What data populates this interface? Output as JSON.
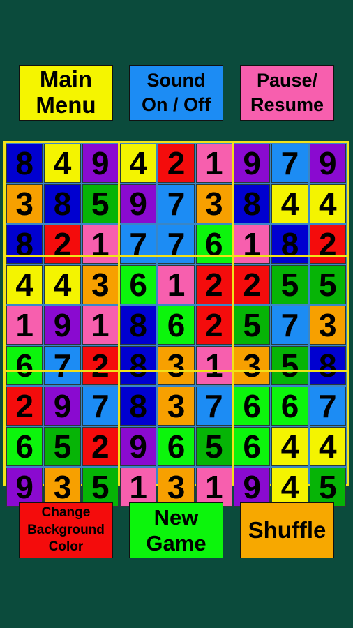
{
  "colors": {
    "background": "#0b4b3c",
    "grid_border": "#f2e21a",
    "digit_colors": {
      "1": "#f75fae",
      "2": "#f40c0c",
      "3": "#f7a000",
      "4": "#f4f400",
      "5": "#06b406",
      "6": "#0cf50c",
      "7": "#1c8cf4",
      "8": "#0000d0",
      "9": "#8a0ad0"
    }
  },
  "top_buttons": {
    "main_menu": {
      "line1": "Main",
      "line2": "Menu",
      "color": "#f5f500"
    },
    "sound": {
      "line1": "Sound",
      "line2": "On / Off",
      "color": "#1c8cf4"
    },
    "pause": {
      "line1": "Pause/",
      "line2": "Resume",
      "color": "#f75fae"
    }
  },
  "bottom_buttons": {
    "change_bg": {
      "line1": "Change",
      "line2": "Background",
      "line3": "Color",
      "color": "#f40c0c"
    },
    "new_game": {
      "line1": "New",
      "line2": "Game",
      "color": "#0cf50c"
    },
    "shuffle": {
      "label": "Shuffle",
      "color": "#f7a800"
    }
  },
  "grid": [
    [
      8,
      4,
      9,
      4,
      2,
      1,
      9,
      7,
      9
    ],
    [
      3,
      8,
      5,
      9,
      7,
      3,
      8,
      4,
      4
    ],
    [
      8,
      2,
      1,
      7,
      7,
      6,
      1,
      8,
      2
    ],
    [
      4,
      4,
      3,
      6,
      1,
      2,
      2,
      5,
      5
    ],
    [
      1,
      9,
      1,
      8,
      6,
      2,
      5,
      7,
      3
    ],
    [
      6,
      7,
      2,
      8,
      3,
      1,
      3,
      5,
      8
    ],
    [
      2,
      9,
      7,
      8,
      3,
      7,
      6,
      6,
      7
    ],
    [
      6,
      5,
      2,
      9,
      6,
      5,
      6,
      4,
      4
    ],
    [
      9,
      3,
      5,
      1,
      3,
      1,
      9,
      4,
      5
    ]
  ]
}
